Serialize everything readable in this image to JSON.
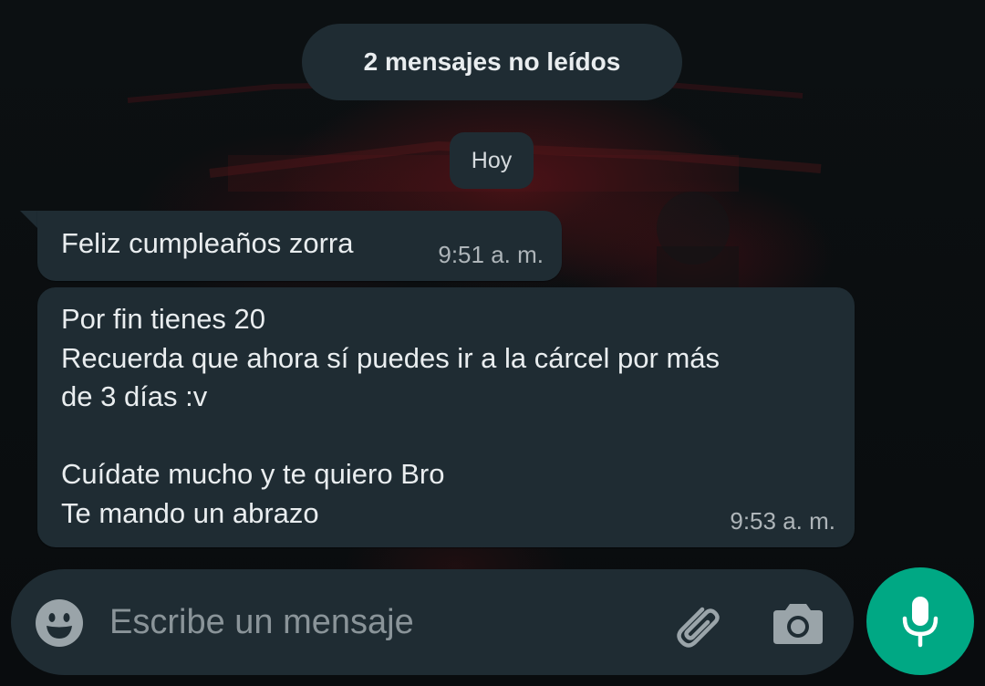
{
  "chat": {
    "unread_banner": "2 mensajes no leídos",
    "date_chip": "Hoy",
    "messages": [
      {
        "lines": [
          "Feliz cumpleaños zorra"
        ],
        "time": "9:51 a. m."
      },
      {
        "lines": [
          "Por fin tienes 20",
          "Recuerda que ahora sí puedes ir a la cárcel por más",
          "de 3 días :v",
          "",
          "Cuídate mucho y te quiero Bro",
          "Te mando un abrazo"
        ],
        "time": "9:53 a. m."
      }
    ]
  },
  "composer": {
    "placeholder": "Escribe un mensaje",
    "value": "",
    "icons": {
      "emoji": "emoji-icon",
      "attach": "paperclip-icon",
      "camera": "camera-icon",
      "mic": "microphone-icon"
    }
  },
  "colors": {
    "bubble": "#1f2c33",
    "text": "#e9edef",
    "timestamp": "#aeb5b9",
    "accent": "#00a884",
    "icon": "#9aa4a9"
  }
}
